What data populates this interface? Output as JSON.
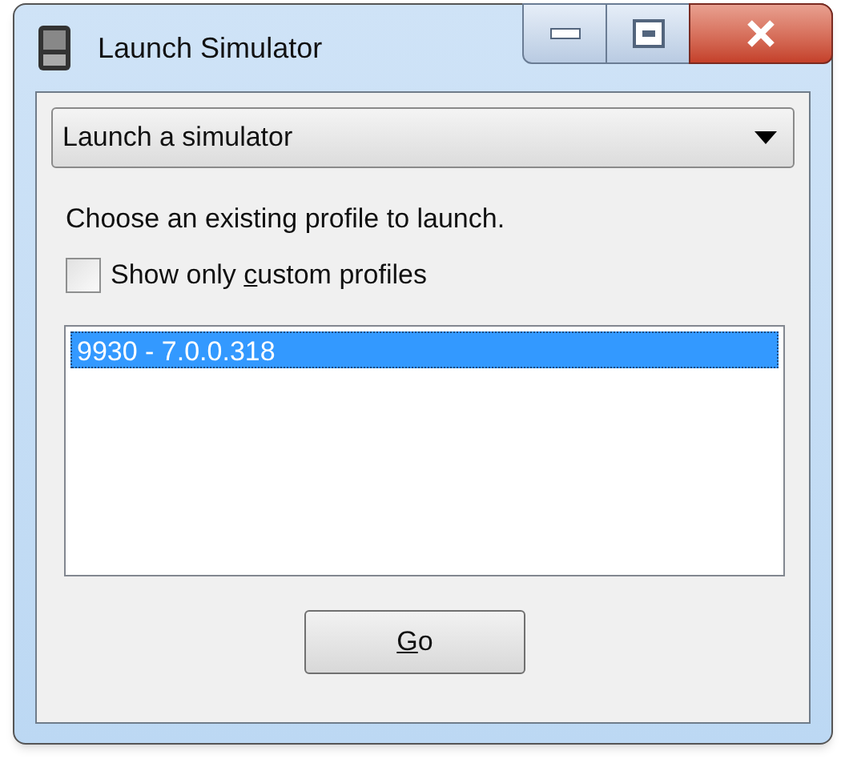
{
  "window": {
    "title": "Launch Simulator"
  },
  "dropdown": {
    "value": "Launch a simulator"
  },
  "instruction": "Choose an existing profile to launch.",
  "checkbox": {
    "label_before": "Show only ",
    "access_key": "c",
    "label_after": "ustom profiles",
    "checked": false
  },
  "profiles": [
    {
      "label": "9930 - 7.0.0.318",
      "selected": true
    }
  ],
  "go_button": {
    "access_key": "G",
    "label_after": "o"
  }
}
